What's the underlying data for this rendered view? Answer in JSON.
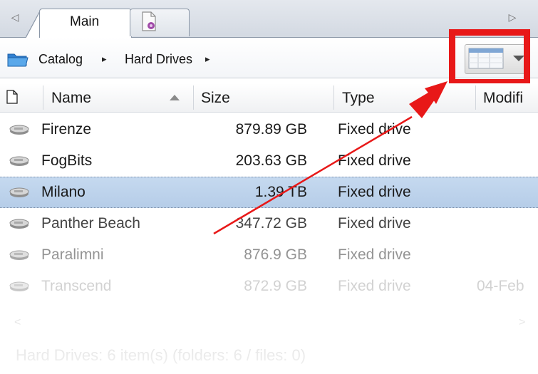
{
  "tabs": [
    {
      "label": "Main"
    },
    {
      "label": ""
    }
  ],
  "icons": {
    "scroll_left": "tab-scroll-left-icon",
    "scroll_right": "tab-scroll-right-icon",
    "folder": "folder-icon",
    "drive": "hard-drive-icon",
    "view_toggle": "details-view-icon"
  },
  "breadcrumb": {
    "items": [
      "Catalog",
      "Hard Drives"
    ],
    "separator": "▸"
  },
  "columns": {
    "name": "Name",
    "size": "Size",
    "type": "Type",
    "modified": "Modifi"
  },
  "rows": [
    {
      "name": "Firenze",
      "size": "879.89 GB",
      "type": "Fixed drive",
      "modified": "",
      "selected": false
    },
    {
      "name": "FogBits",
      "size": "203.63 GB",
      "type": "Fixed drive",
      "modified": "",
      "selected": false
    },
    {
      "name": "Milano",
      "size": "1.39 TB",
      "type": "Fixed drive",
      "modified": "",
      "selected": true
    },
    {
      "name": "Panther Beach",
      "size": "347.72 GB",
      "type": "Fixed drive",
      "modified": "",
      "selected": false
    },
    {
      "name": "Paralimni",
      "size": "876.9 GB",
      "type": "Fixed drive",
      "modified": "",
      "selected": false
    },
    {
      "name": "Transcend",
      "size": "872.9 GB",
      "type": "Fixed drive",
      "modified": "04-Feb",
      "selected": false
    }
  ],
  "status": "Hard Drives: 6 item(s) (folders: 6 / files: 0)",
  "colors": {
    "highlight": "#e81818",
    "selection": "#b6cde8"
  }
}
